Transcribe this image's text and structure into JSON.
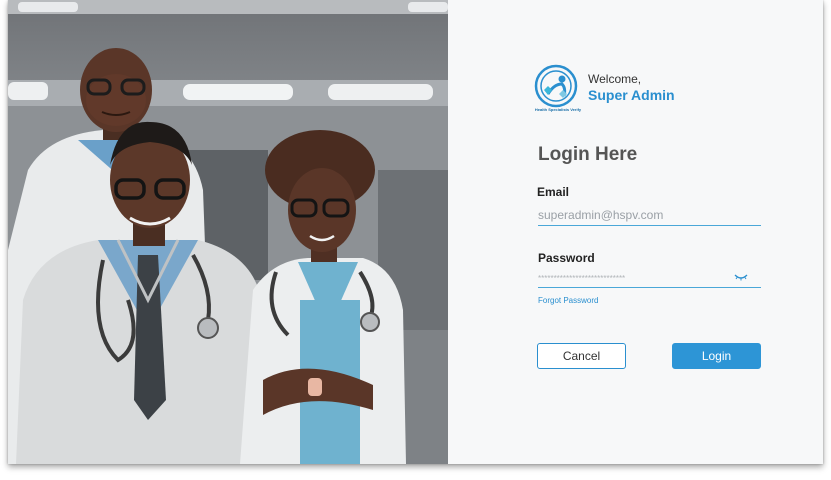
{
  "brand": {
    "logo_caption": "Health Specialists Verify",
    "welcome": "Welcome,",
    "role": "Super Admin"
  },
  "form": {
    "title": "Login Here",
    "email_label": "Email",
    "email_placeholder": "superadmin@hspv.com",
    "password_label": "Password",
    "password_placeholder": "****************************",
    "forgot_password": "Forgot Password",
    "cancel_label": "Cancel",
    "login_label": "Login"
  },
  "icons": {
    "eye": "eye-closed-icon",
    "logo": "health-logo-icon"
  },
  "colors": {
    "accent": "#2d95d6",
    "panel_bg": "#f7f8f9",
    "input_underline": "#4aa7d8"
  }
}
